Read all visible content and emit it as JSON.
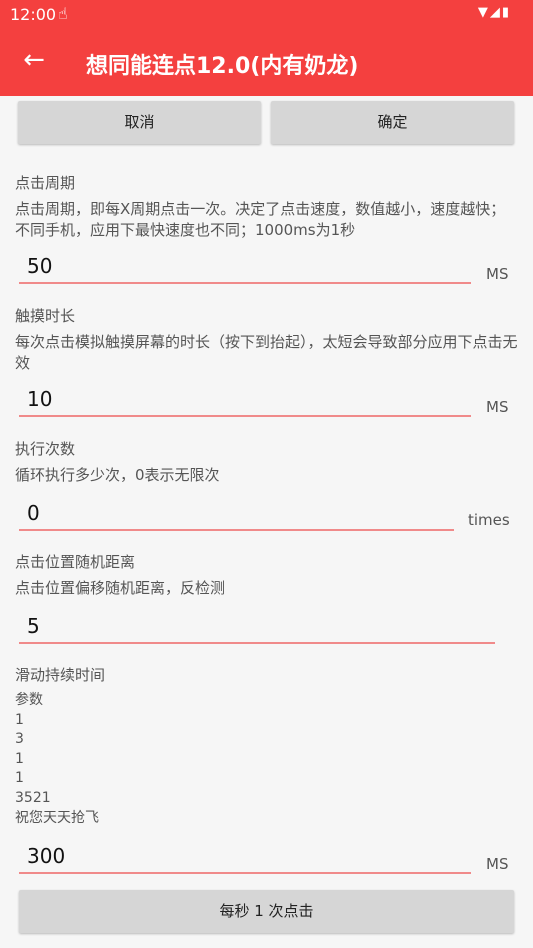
{
  "status_bar": {
    "time": "12:00"
  },
  "app_bar": {
    "title": "想同能连点12.0(内有奶龙)"
  },
  "actions": {
    "cancel": "取消",
    "confirm": "确定"
  },
  "click_period": {
    "label": "点击周期",
    "description": "点击周期，即每X周期点击一次。决定了点击速度，数值越小，速度越快；不同手机，应用下最快速度也不同；1000ms为1秒",
    "value": "50",
    "unit": "MS"
  },
  "touch_duration": {
    "label": "触摸时长",
    "description": "每次点击模拟触摸屏幕的时长（按下到抬起），太短会导致部分应用下点击无效",
    "value": "10",
    "unit": "MS"
  },
  "execution_count": {
    "label": "执行次数",
    "description": "循环执行多少次，0表示无限次",
    "value": "0",
    "unit": "times"
  },
  "random_distance": {
    "label": "点击位置随机距离",
    "description": "点击位置偏移随机距离，反检测",
    "value": "5"
  },
  "swipe_duration": {
    "label": "滑动持续时间",
    "params": [
      "参数",
      "1",
      "3",
      "1",
      "1",
      "3521",
      "祝您天天抢飞"
    ],
    "value": "300",
    "unit": "MS"
  },
  "bottom_button": {
    "label": "每秒 1 次点击"
  },
  "icons": {
    "back": "arrow-left",
    "touch": "hand-touch",
    "wifi": "wifi",
    "signal": "cell-signal",
    "battery": "battery-charging"
  }
}
